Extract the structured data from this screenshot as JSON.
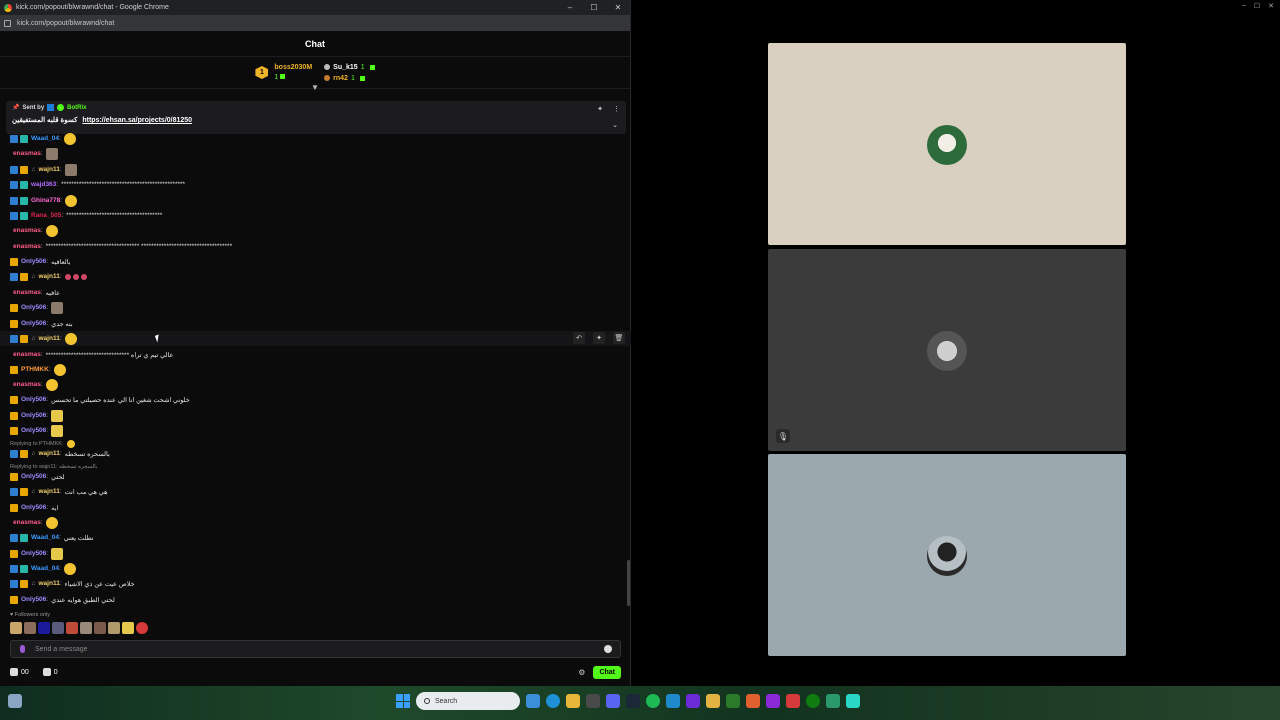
{
  "window": {
    "title": "kick.com/popout/blwrawnd/chat - Google Chrome",
    "url": "kick.com/popout/blwrawnd/chat"
  },
  "chat": {
    "header": "Chat",
    "leaderboard": {
      "top_rank": "1",
      "top_name": "boss2030M",
      "top_count": "1",
      "second_name": "Su_k15",
      "second_count": "1",
      "third_name": "rn42",
      "third_count": "1"
    },
    "pinned": {
      "sent_by": "Sent by",
      "bot_name": "BotRix",
      "message_prefix": "كسوة قلبه المستفيقين",
      "link": "https://ehsan.sa/projects/0/81250"
    },
    "messages": [
      {
        "badges": [
          "blue",
          "teal"
        ],
        "user": "Waad_04",
        "color": "#3b9bff",
        "text": "",
        "emotes": [
          "yellow"
        ]
      },
      {
        "badges": [],
        "user": "enasmas",
        "color": "#ff5c8a",
        "text": "",
        "emotes": [
          "face"
        ]
      },
      {
        "badges": [
          "blue",
          "gold"
        ],
        "user": "wajn11",
        "color": "#f3d16b",
        "text": "",
        "emotes": [
          "face"
        ],
        "dot": true
      },
      {
        "badges": [
          "blue",
          "teal"
        ],
        "user": "wajd363",
        "color": "#b46cff",
        "text": "*************************************************",
        "emotes": []
      },
      {
        "badges": [
          "blue",
          "teal"
        ],
        "user": "Ghina778",
        "color": "#ff6ad5",
        "text": "",
        "emotes": [
          "yellow"
        ]
      },
      {
        "badges": [
          "blue",
          "teal"
        ],
        "user": "Rana_505",
        "color": "#e0284f",
        "text": "**************************************",
        "emotes": []
      },
      {
        "badges": [],
        "user": "enasmas",
        "color": "#ff5c8a",
        "text": "",
        "emotes": [
          "yellow"
        ]
      },
      {
        "badges": [],
        "user": "enasmas",
        "color": "#ff5c8a",
        "text": "************************************* ************************************",
        "emotes": []
      },
      {
        "badges": [
          "gold"
        ],
        "user": "Only506",
        "color": "#9f8cff",
        "text": "بالعافيه",
        "emotes": []
      },
      {
        "badges": [
          "blue",
          "gold"
        ],
        "user": "wajn11",
        "color": "#f3d16b",
        "text": "",
        "emotes": [
          "red",
          "red",
          "red"
        ],
        "dot": true
      },
      {
        "badges": [],
        "user": "enasmas",
        "color": "#ff5c8a",
        "text": "عافيه",
        "emotes": []
      },
      {
        "badges": [
          "gold"
        ],
        "user": "Only506",
        "color": "#9f8cff",
        "text": "",
        "emotes": [
          "face"
        ]
      },
      {
        "badges": [
          "gold"
        ],
        "user": "Only506",
        "color": "#9f8cff",
        "text": "بنه جدي",
        "emotes": []
      },
      {
        "badges": [
          "blue",
          "gold"
        ],
        "user": "wajn11",
        "color": "#f3d16b",
        "text": "",
        "emotes": [
          "yellow"
        ],
        "dot": true
      },
      {
        "badges": [],
        "user": "enasmas",
        "color": "#ff5c8a",
        "text": "********************************* عالي تيم ي تراه",
        "emotes": []
      },
      {
        "badges": [
          "gold"
        ],
        "user": "PTHMKK",
        "color": "#ff9b3b",
        "text": "",
        "emotes": [
          "yellow"
        ]
      },
      {
        "badges": [],
        "user": "enasmas",
        "color": "#ff5c8a",
        "text": "",
        "emotes": [
          "yellow"
        ]
      },
      {
        "badges": [
          "gold"
        ],
        "user": "Only506",
        "color": "#9f8cff",
        "text": "خلوني اشحت شغين انا الي عنده حصيلتي ما تحسس",
        "emotes": []
      },
      {
        "badges": [
          "gold"
        ],
        "user": "Only506",
        "color": "#9f8cff",
        "text": "",
        "emotes": [
          "banana"
        ]
      },
      {
        "badges": [
          "gold"
        ],
        "user": "Only506",
        "color": "#9f8cff",
        "text": "",
        "emotes": [
          "banana"
        ]
      }
    ],
    "reply1": "Replying to PTHMKK:",
    "reply_msg1": {
      "user": "wajn11",
      "color": "#f3d16b",
      "text": "بالسحره تسخطه"
    },
    "reply2": "Replying to wajn11: بالسحره تسخطه",
    "messages2": [
      {
        "badges": [
          "gold"
        ],
        "user": "Only506",
        "color": "#9f8cff",
        "text": "لحتي",
        "emotes": []
      },
      {
        "badges": [
          "blue",
          "gold"
        ],
        "user": "wajn11",
        "color": "#f3d16b",
        "text": "هي هي مب انت",
        "emotes": [],
        "dot": true
      },
      {
        "badges": [
          "gold"
        ],
        "user": "Only506",
        "color": "#9f8cff",
        "text": "ايه",
        "emotes": []
      },
      {
        "badges": [],
        "user": "enasmas",
        "color": "#ff5c8a",
        "text": "",
        "emotes": [
          "yellow"
        ]
      },
      {
        "badges": [
          "blue",
          "teal"
        ],
        "user": "Waad_04",
        "color": "#3b9bff",
        "text": "نطلت يعني",
        "emotes": []
      },
      {
        "badges": [
          "gold"
        ],
        "user": "Only506",
        "color": "#9f8cff",
        "text": "",
        "emotes": [
          "banana"
        ]
      },
      {
        "badges": [
          "blue",
          "teal"
        ],
        "user": "Waad_04",
        "color": "#3b9bff",
        "text": "",
        "emotes": [
          "yellow"
        ]
      },
      {
        "badges": [
          "blue",
          "gold"
        ],
        "user": "wajn11",
        "color": "#f3d16b",
        "text": "خلاص عيت عن ذي الاشياء",
        "emotes": [],
        "dot": true
      },
      {
        "badges": [
          "gold"
        ],
        "user": "Only506",
        "color": "#9f8cff",
        "text": "لحتي الطبق هوايه عندي",
        "emotes": []
      }
    ],
    "followers_only": "Followers only",
    "input_placeholder": "Send a message",
    "viewers": "00",
    "chest_count": "0",
    "chat_button": "Chat"
  },
  "taskbar": {
    "search_placeholder": "Search"
  },
  "colors": {
    "accent": "#53fc18",
    "background": "#0b0b0c"
  }
}
